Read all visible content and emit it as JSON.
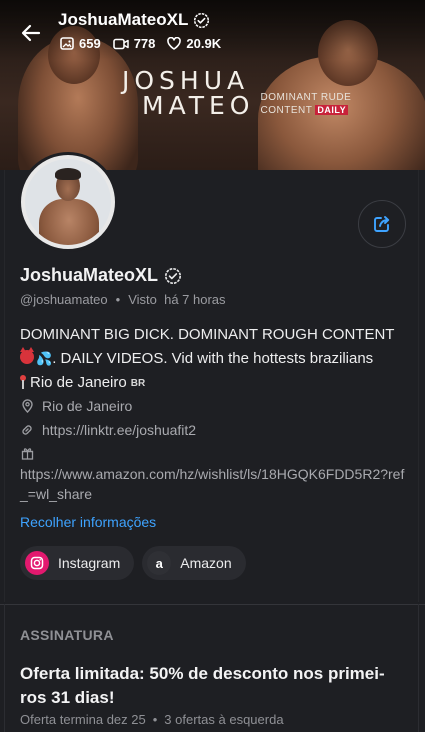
{
  "header": {
    "username": "JoshuaMateoXL",
    "stats": {
      "photos": "659",
      "videos": "778",
      "likes": "20.9K"
    },
    "brand": {
      "line1": "JOSHUA",
      "line2": "MATEO",
      "tagline_line1": "DOMINANT RUDE",
      "tagline_line2": "CONTENT",
      "tagline_badge": "DAILY"
    }
  },
  "profile": {
    "name": "JoshuaMateoXL",
    "handle": "@joshuamateo",
    "seen_label": "Visto",
    "seen_time": "há 7 horas",
    "bio_line1": "DOMINANT BIG DICK. DOMINANT ROUGH CONTENT",
    "bio_line2": ". DAILY VIDEOS. Vid with the hottests brazilians",
    "bio_location": "Rio de Janeiro",
    "bio_flag": "BR",
    "location": "Rio de Janeiro",
    "link": "https://linktr.ee/joshuafit2",
    "wishlist": "https://www.amazon.com/hz/wishlist/ls/18HGQK6FDD5R2?ref_=wl_share",
    "collapse_label": "Recolher informações",
    "chips": [
      {
        "label": "Instagram",
        "icon": "instagram-icon"
      },
      {
        "label": "Amazon",
        "icon": "amazon-icon",
        "glyph": "a"
      }
    ]
  },
  "subscription": {
    "title": "ASSINATURA",
    "offer": "Oferta limitada: 50% de desconto nos primei-ros 31 dias!",
    "offer_ends": "Oferta termina dez 25",
    "offers_left": "3 ofertas à esquerda"
  },
  "colors": {
    "accent": "#3ea3ff",
    "background": "#1e1f23",
    "instagram": "#e3196f",
    "daily_badge": "#c8223a"
  }
}
